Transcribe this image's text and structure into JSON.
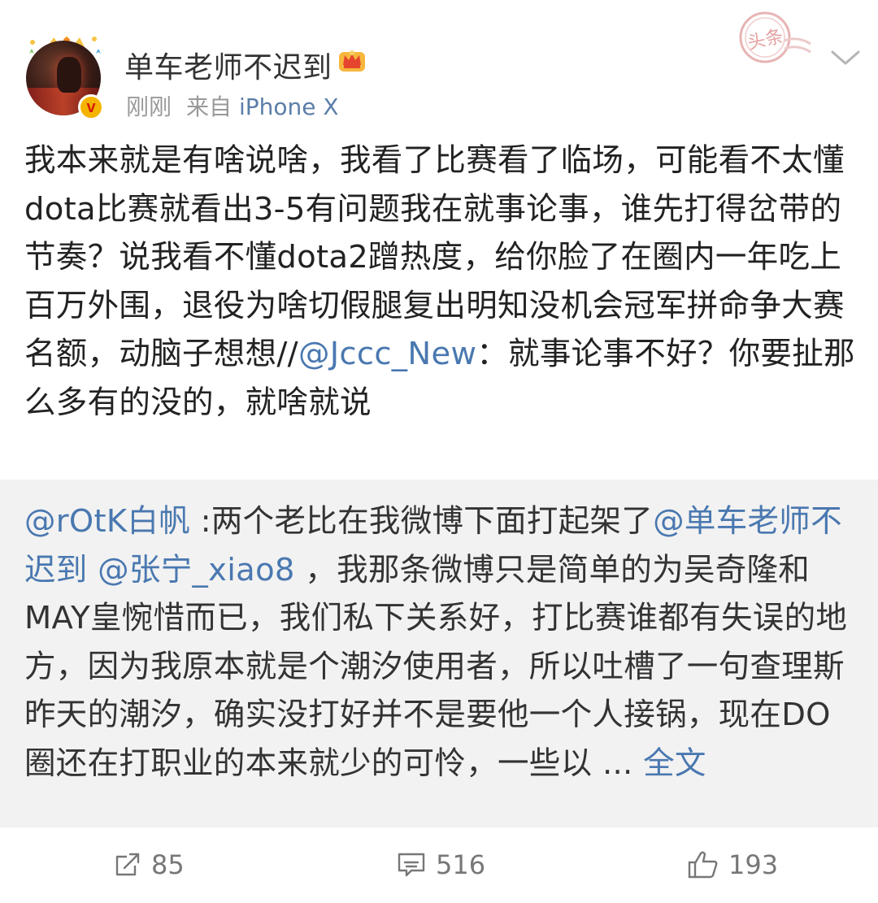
{
  "post": {
    "author": "单车老师不迟到",
    "time": "刚刚",
    "source_prefix": "来自",
    "source": "iPhone X",
    "stamp_text": "头条",
    "text_main": "我本来就是有啥说啥，我看了比赛看了临场，可能看不太懂dota比赛就看出3-5有问题我在就事论事，谁先打得岔带的节奏？说我看不懂dota2蹭热度，给你脸了在圈内一年吃上百万外围，退役为啥切假腿复出明知没机会冠军拼命争大赛名额，动脑子想想//",
    "reply_mention": "@Jccc_New",
    "reply_text": "：就事论事不好？你要扯那么多有的没的，就啥就说"
  },
  "retweet": {
    "author_mention": "@rOtK白帆",
    "text_1": " :两个老比在我微博下面打起架了",
    "mention_1": "@单车老师不迟到",
    "mention_2": "@张宁_xiao8",
    "text_2": " ，我那条微博只是简单的为吴奇隆和MAY皇惋惜而已，我们私下关系好，打比赛谁都有失误的地方，因为我原本就是个潮汐使用者，所以吐槽了一句查理斯昨天的潮汐，确实没打好并不是要他一个人接锅，现在DO圈还在打职业的本来就少的可怜，一些以 ... ",
    "more_label": "全文"
  },
  "actions": {
    "repost_count": "85",
    "comment_count": "516",
    "like_count": "193"
  },
  "colors": {
    "link": "#4a78b0",
    "meta": "#999999",
    "retweet_bg": "#f2f2f2",
    "badge": "#f5b400"
  },
  "icons": [
    "avatar",
    "verified-v-icon",
    "vip-crown-icon",
    "headline-stamp-icon",
    "chevron-down-icon",
    "repost-icon",
    "comment-icon",
    "like-icon"
  ]
}
